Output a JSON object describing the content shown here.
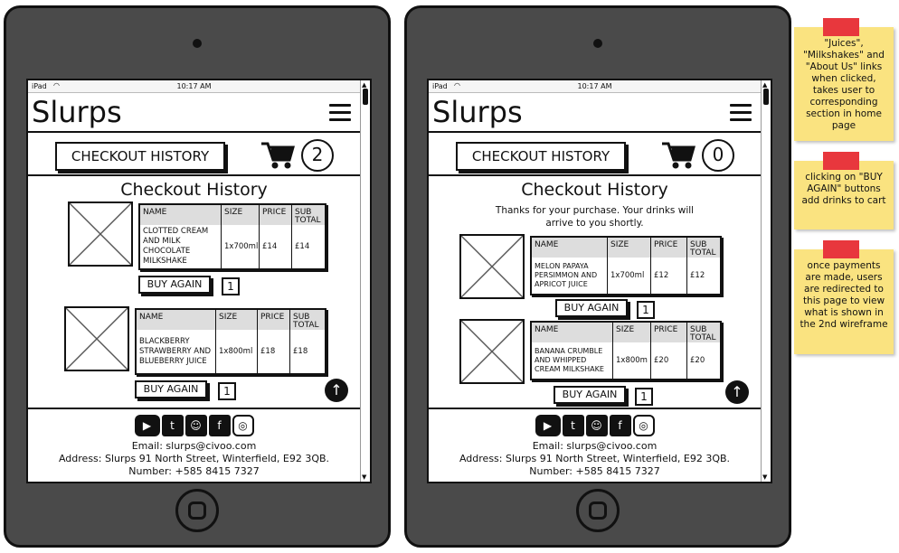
{
  "status_bar": {
    "device": "iPad",
    "time": "10:17 AM"
  },
  "app": {
    "logo": "Slurps"
  },
  "nav": {
    "checkout_history_label": "CHECKOUT HISTORY"
  },
  "page": {
    "title": "Checkout History"
  },
  "table_headers": {
    "name": "NAME",
    "size": "SIZE",
    "price": "PRICE",
    "sub_total": "SUB TOTAL"
  },
  "buy_again_label": "BUY AGAIN",
  "wireframe1": {
    "cart_count": "2",
    "items": [
      {
        "name": "CLOTTED CREAM AND MILK CHOCOLATE MILKSHAKE",
        "size": "1x700ml",
        "price": "£14",
        "sub_total": "£14",
        "qty": "1"
      },
      {
        "name": "BLACKBERRY STRAWBERRY AND BLUEBERRY JUICE",
        "size": "1x800ml",
        "price": "£18",
        "sub_total": "£18",
        "qty": "1"
      }
    ]
  },
  "wireframe2": {
    "cart_count": "0",
    "thanks_line1": "Thanks for your purchase. Your drinks will",
    "thanks_line2": "arrive to you shortly.",
    "items": [
      {
        "name": "MELON PAPAYA PERSIMMON AND APRICOT JUICE",
        "size": "1x700ml",
        "price": "£12",
        "sub_total": "£12",
        "qty": "1"
      },
      {
        "name": "BANANA CRUMBLE AND WHIPPED CREAM MILKSHAKE",
        "size": "1x800m",
        "price": "£20",
        "sub_total": "£20",
        "qty": "1"
      }
    ]
  },
  "footer": {
    "socials": [
      "youtube-icon",
      "twitter-icon",
      "snapchat-icon",
      "facebook-icon",
      "instagram-icon"
    ],
    "email": "Email: slurps@civoo.com",
    "address": "Address: Slurps 91 North Street, Winterfield, E92 3QB.",
    "number": "Number: +585 8415 7327"
  },
  "notes": [
    "\"Juices\", \"Milkshakes\" and \"About Us\" links when clicked, takes user to corresponding section in home page",
    "clicking on \"BUY AGAIN\" buttons add drinks to cart",
    "once payments are made, users are redirected to this page to view what is shown in the 2nd wireframe"
  ],
  "colors": {
    "tablet_frame": "#4a4a4a",
    "sticky_note": "#fae380",
    "tape": "#e8373d",
    "header_gray": "#dddddd"
  }
}
